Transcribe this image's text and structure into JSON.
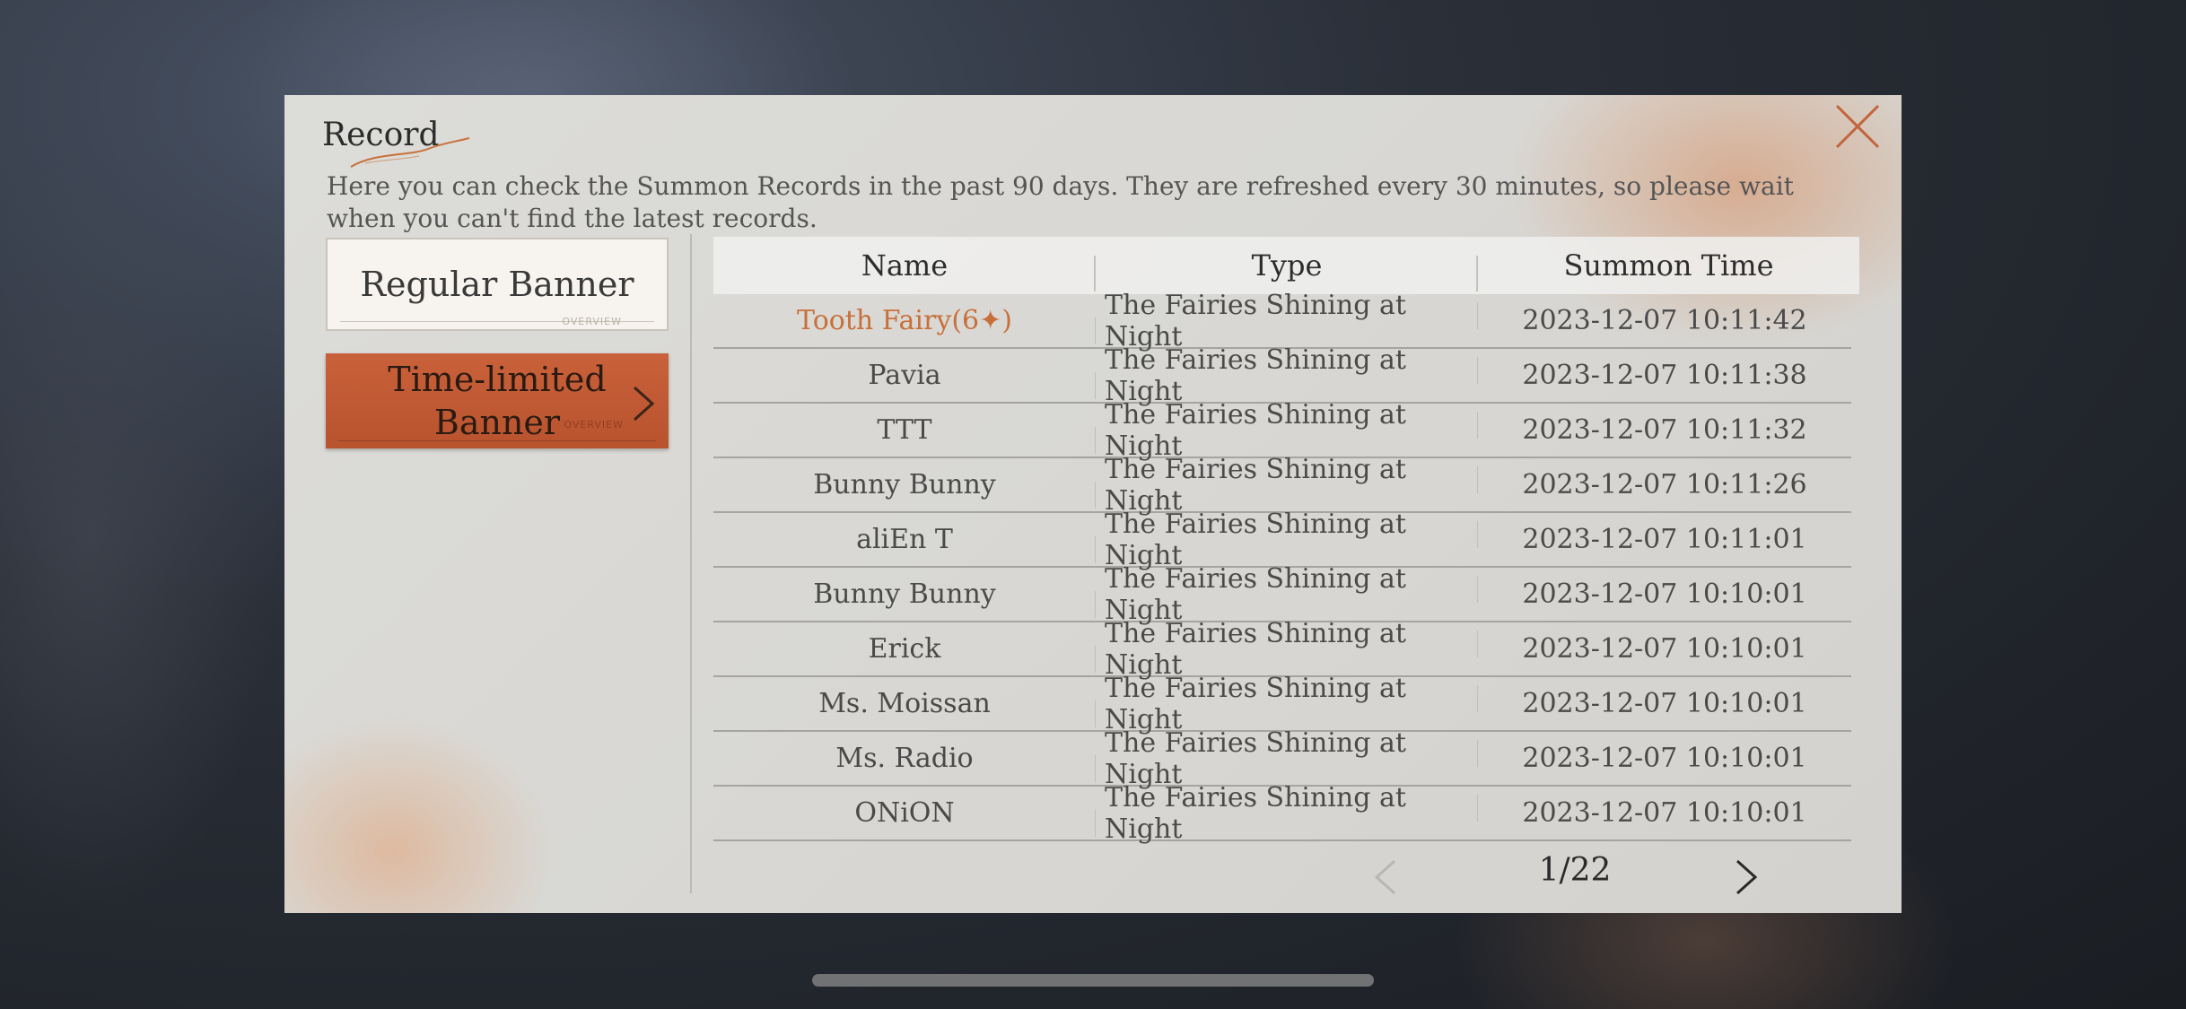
{
  "dialog": {
    "title": "Record",
    "description": "Here you can check the Summon Records in the past 90 days. They are refreshed every 30 minutes, so please wait when you can't find the latest records.",
    "close_icon": "close-icon"
  },
  "banners": {
    "regular": {
      "label": "Regular Banner",
      "tag": "OVERVIEW"
    },
    "limited": {
      "label": "Time-limited Banner",
      "tag": "OVERVIEW",
      "selected": true
    }
  },
  "table": {
    "headers": {
      "name": "Name",
      "type": "Type",
      "time": "Summon Time"
    },
    "rows": [
      {
        "name": "Tooth Fairy(6✦)",
        "type": "The Fairies Shining at Night",
        "time": "2023-12-07 10:11:42",
        "highlight": true
      },
      {
        "name": "Pavia",
        "type": "The Fairies Shining at Night",
        "time": "2023-12-07 10:11:38"
      },
      {
        "name": "TTT",
        "type": "The Fairies Shining at Night",
        "time": "2023-12-07 10:11:32"
      },
      {
        "name": "Bunny Bunny",
        "type": "The Fairies Shining at Night",
        "time": "2023-12-07 10:11:26"
      },
      {
        "name": "aliEn T",
        "type": "The Fairies Shining at Night",
        "time": "2023-12-07 10:11:01"
      },
      {
        "name": "Bunny Bunny",
        "type": "The Fairies Shining at Night",
        "time": "2023-12-07 10:10:01"
      },
      {
        "name": "Erick",
        "type": "The Fairies Shining at Night",
        "time": "2023-12-07 10:10:01"
      },
      {
        "name": "Ms. Moissan",
        "type": "The Fairies Shining at Night",
        "time": "2023-12-07 10:10:01"
      },
      {
        "name": "Ms. Radio",
        "type": "The Fairies Shining at Night",
        "time": "2023-12-07 10:10:01"
      },
      {
        "name": "ONiON",
        "type": "The Fairies Shining at Night",
        "time": "2023-12-07 10:10:01"
      }
    ]
  },
  "pagination": {
    "text": "1/22",
    "current": 1,
    "total": 22
  },
  "colors": {
    "accent": "#c8703a",
    "banner_selected": "#bf5a33",
    "panel": "#d9d8d4"
  }
}
